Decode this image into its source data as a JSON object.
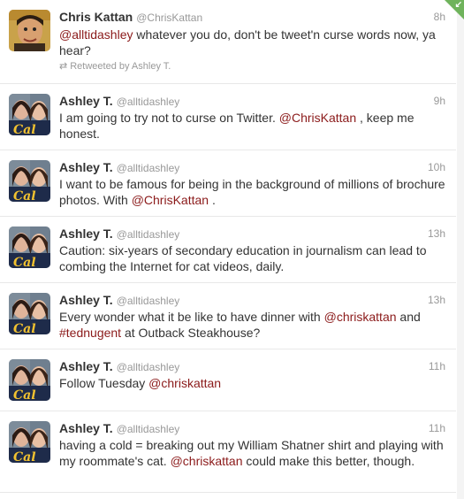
{
  "tweets": [
    {
      "name": "Chris Kattan",
      "handle": "@ChrisKattan",
      "time": "8h",
      "avatar": "chris",
      "text": [
        {
          "t": "mention",
          "v": "@alltidashley"
        },
        {
          "t": "text",
          "v": " whatever you do, don't be tweet'n curse words now, ya hear?"
        }
      ],
      "retweeted_by": "Retweeted by Ashley T."
    },
    {
      "name": "Ashley T.",
      "handle": "@alltidashley",
      "time": "9h",
      "avatar": "ashley",
      "text": [
        {
          "t": "text",
          "v": "I am going to try not to curse on Twitter. "
        },
        {
          "t": "mention",
          "v": "@ChrisKattan"
        },
        {
          "t": "text",
          "v": " , keep me honest."
        }
      ]
    },
    {
      "name": "Ashley T.",
      "handle": "@alltidashley",
      "time": "10h",
      "avatar": "ashley",
      "text": [
        {
          "t": "text",
          "v": "I want to be famous for being in the background of millions of brochure photos. With "
        },
        {
          "t": "mention",
          "v": "@ChrisKattan"
        },
        {
          "t": "text",
          "v": " ."
        }
      ]
    },
    {
      "name": "Ashley T.",
      "handle": "@alltidashley",
      "time": "13h",
      "avatar": "ashley",
      "text": [
        {
          "t": "text",
          "v": "Caution: six-years of secondary education in journalism can lead to combing the Internet for cat videos, daily."
        }
      ]
    },
    {
      "name": "Ashley T.",
      "handle": "@alltidashley",
      "time": "13h",
      "avatar": "ashley",
      "text": [
        {
          "t": "text",
          "v": "Every wonder what it be like to have dinner with "
        },
        {
          "t": "mention",
          "v": "@chriskattan"
        },
        {
          "t": "text",
          "v": " and "
        },
        {
          "t": "hashtag",
          "v": "#tednugent"
        },
        {
          "t": "text",
          "v": " at Outback Steakhouse?"
        }
      ]
    },
    {
      "name": "Ashley T.",
      "handle": "@alltidashley",
      "time": "11h",
      "avatar": "ashley",
      "text": [
        {
          "t": "text",
          "v": "Follow Tuesday "
        },
        {
          "t": "mention",
          "v": "@chriskattan"
        }
      ]
    },
    {
      "name": "Ashley T.",
      "handle": "@alltidashley",
      "time": "11h",
      "avatar": "ashley",
      "text": [
        {
          "t": "text",
          "v": "having a cold = breaking out my William Shatner shirt and playing with my roommate's cat. "
        },
        {
          "t": "mention",
          "v": "@chriskattan"
        },
        {
          "t": "text",
          "v": " could make this better, though."
        }
      ]
    }
  ],
  "colors": {
    "mention": "#8b1a1a",
    "corner": "#6fb35c"
  },
  "icons": {
    "retweet": "retweet-icon",
    "corner": "new-tweet-corner-icon"
  },
  "avatar_text": {
    "ashley": "Cal"
  }
}
